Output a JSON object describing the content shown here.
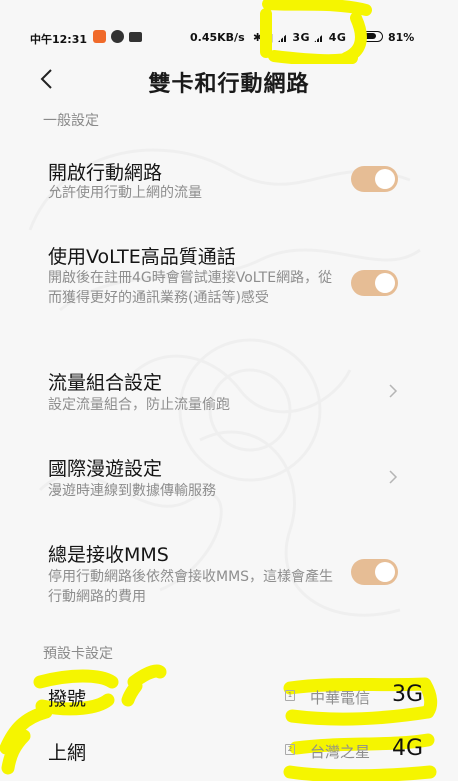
{
  "status_bar": {
    "time": "中午12:31",
    "speed": "0.45KB/s",
    "net_1": "3G",
    "net_2": "4G",
    "battery": "81%"
  },
  "header": {
    "title": "雙卡和行動網路",
    "back_icon": "chevron-left-icon"
  },
  "sections": {
    "general": "一般設定",
    "default_card": "預設卡設定"
  },
  "settings": [
    {
      "title": "開啟行動網路",
      "desc": "允許使用行動上網的流量",
      "control": "toggle",
      "on": true
    },
    {
      "title": "使用VoLTE高品質通話",
      "desc": "開啟後在註冊4G時會嘗試連接VoLTE網路，從而獲得更好的通訊業務(通話等)感受",
      "control": "toggle",
      "on": true
    },
    {
      "title": "流量組合設定",
      "desc": "設定流量組合，防止流量偷跑",
      "control": "chevron"
    },
    {
      "title": "國際漫遊設定",
      "desc": "漫遊時連線到數據傳輸服務",
      "control": "chevron"
    },
    {
      "title": "總是接收MMS",
      "desc": "停用行動網路後依然會接收MMS，這樣會產生行動網路的費用",
      "control": "toggle",
      "on": true
    }
  ],
  "default_card": [
    {
      "label": "撥號",
      "sim": "1",
      "carrier": "中華電信",
      "type": "3G"
    },
    {
      "label": "上網",
      "sim": "2",
      "carrier": "台灣之星",
      "type": "4G"
    }
  ],
  "colors": {
    "toggle_on": "#e6bd95",
    "highlighter": "#f5f500",
    "background": "#f7f7f7"
  }
}
